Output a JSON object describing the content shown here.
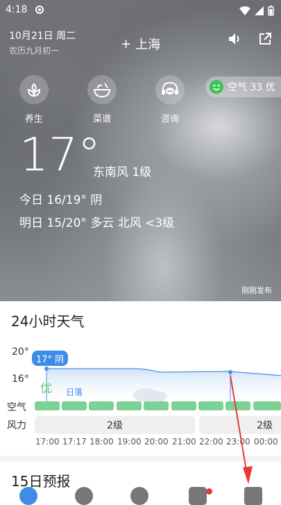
{
  "status": {
    "time": "4:18"
  },
  "header": {
    "date": "10月21日 周二",
    "lunar": "农历九月初一",
    "city_prefix": "+",
    "city": "上海"
  },
  "actions": [
    {
      "label": "养生",
      "icon": "health-icon"
    },
    {
      "label": "菜谱",
      "icon": "recipe-bowl-icon"
    },
    {
      "label": "咨询",
      "icon": "headset-chat-icon"
    }
  ],
  "aqi": {
    "label": "空气 33 优",
    "color": "#3fc35a"
  },
  "current": {
    "temp": "17°",
    "wind": "东南风 1级",
    "today": "今日 16/19° 阴",
    "tomorrow": "明日 15/20° 多云 北风 <3级",
    "published": "刚刚发布"
  },
  "hourly": {
    "title": "24小时天气",
    "ytick_high": "20°",
    "ytick_low": "16°",
    "badge": "17° 阴",
    "quality_marker": "优",
    "sunset_label": "日落",
    "row_air_label": "空气",
    "row_wind_label": "风力",
    "wind_pill_1": "2级",
    "wind_pill_2": "2级",
    "hours": [
      "17:00",
      "17:17",
      "18:00",
      "19:00",
      "20:00",
      "21:00",
      "22:00",
      "23:00",
      "00:00"
    ]
  },
  "forecast": {
    "title": "15日预报"
  },
  "colors": {
    "accent": "#3d8ce8",
    "air_good": "#7ed195",
    "annotation": "#e53935"
  }
}
